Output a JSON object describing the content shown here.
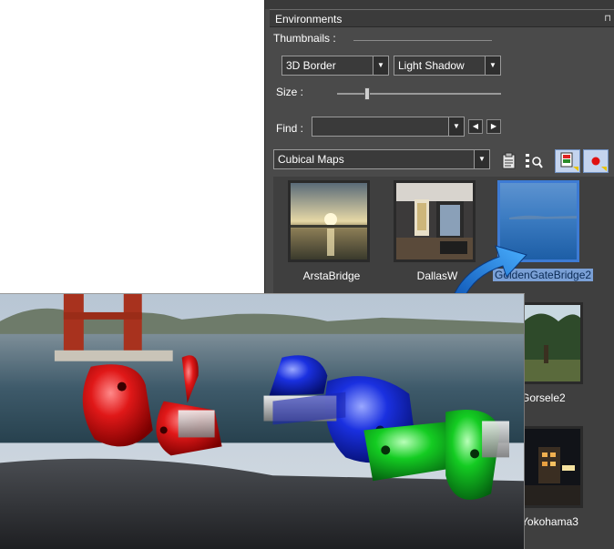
{
  "panel": {
    "title": "Environments",
    "pin_glyph": "⊓",
    "thumbnails_label": "Thumbnails :",
    "border_style": "3D Border",
    "shadow_style": "Light Shadow",
    "size_label": "Size :",
    "find_label": "Find :",
    "find_value": "",
    "category": "Cubical Maps"
  },
  "thumbnails": [
    {
      "name": "ArstaBridge"
    },
    {
      "name": "DallasW"
    },
    {
      "name": "GoldenGateBridge2"
    },
    {
      "name": "Gorsele2"
    },
    {
      "name": "Yokohama3"
    }
  ],
  "icons": {
    "dropdown": "dropdown-arrow-icon",
    "prev": "prev-arrow-icon",
    "next": "next-arrow-icon"
  },
  "colors": {
    "panel_bg": "#4a4a4a",
    "selection": "#7aa0d6",
    "clip_red": "#d81010",
    "clip_blue": "#1830e0",
    "clip_green": "#10c820"
  }
}
